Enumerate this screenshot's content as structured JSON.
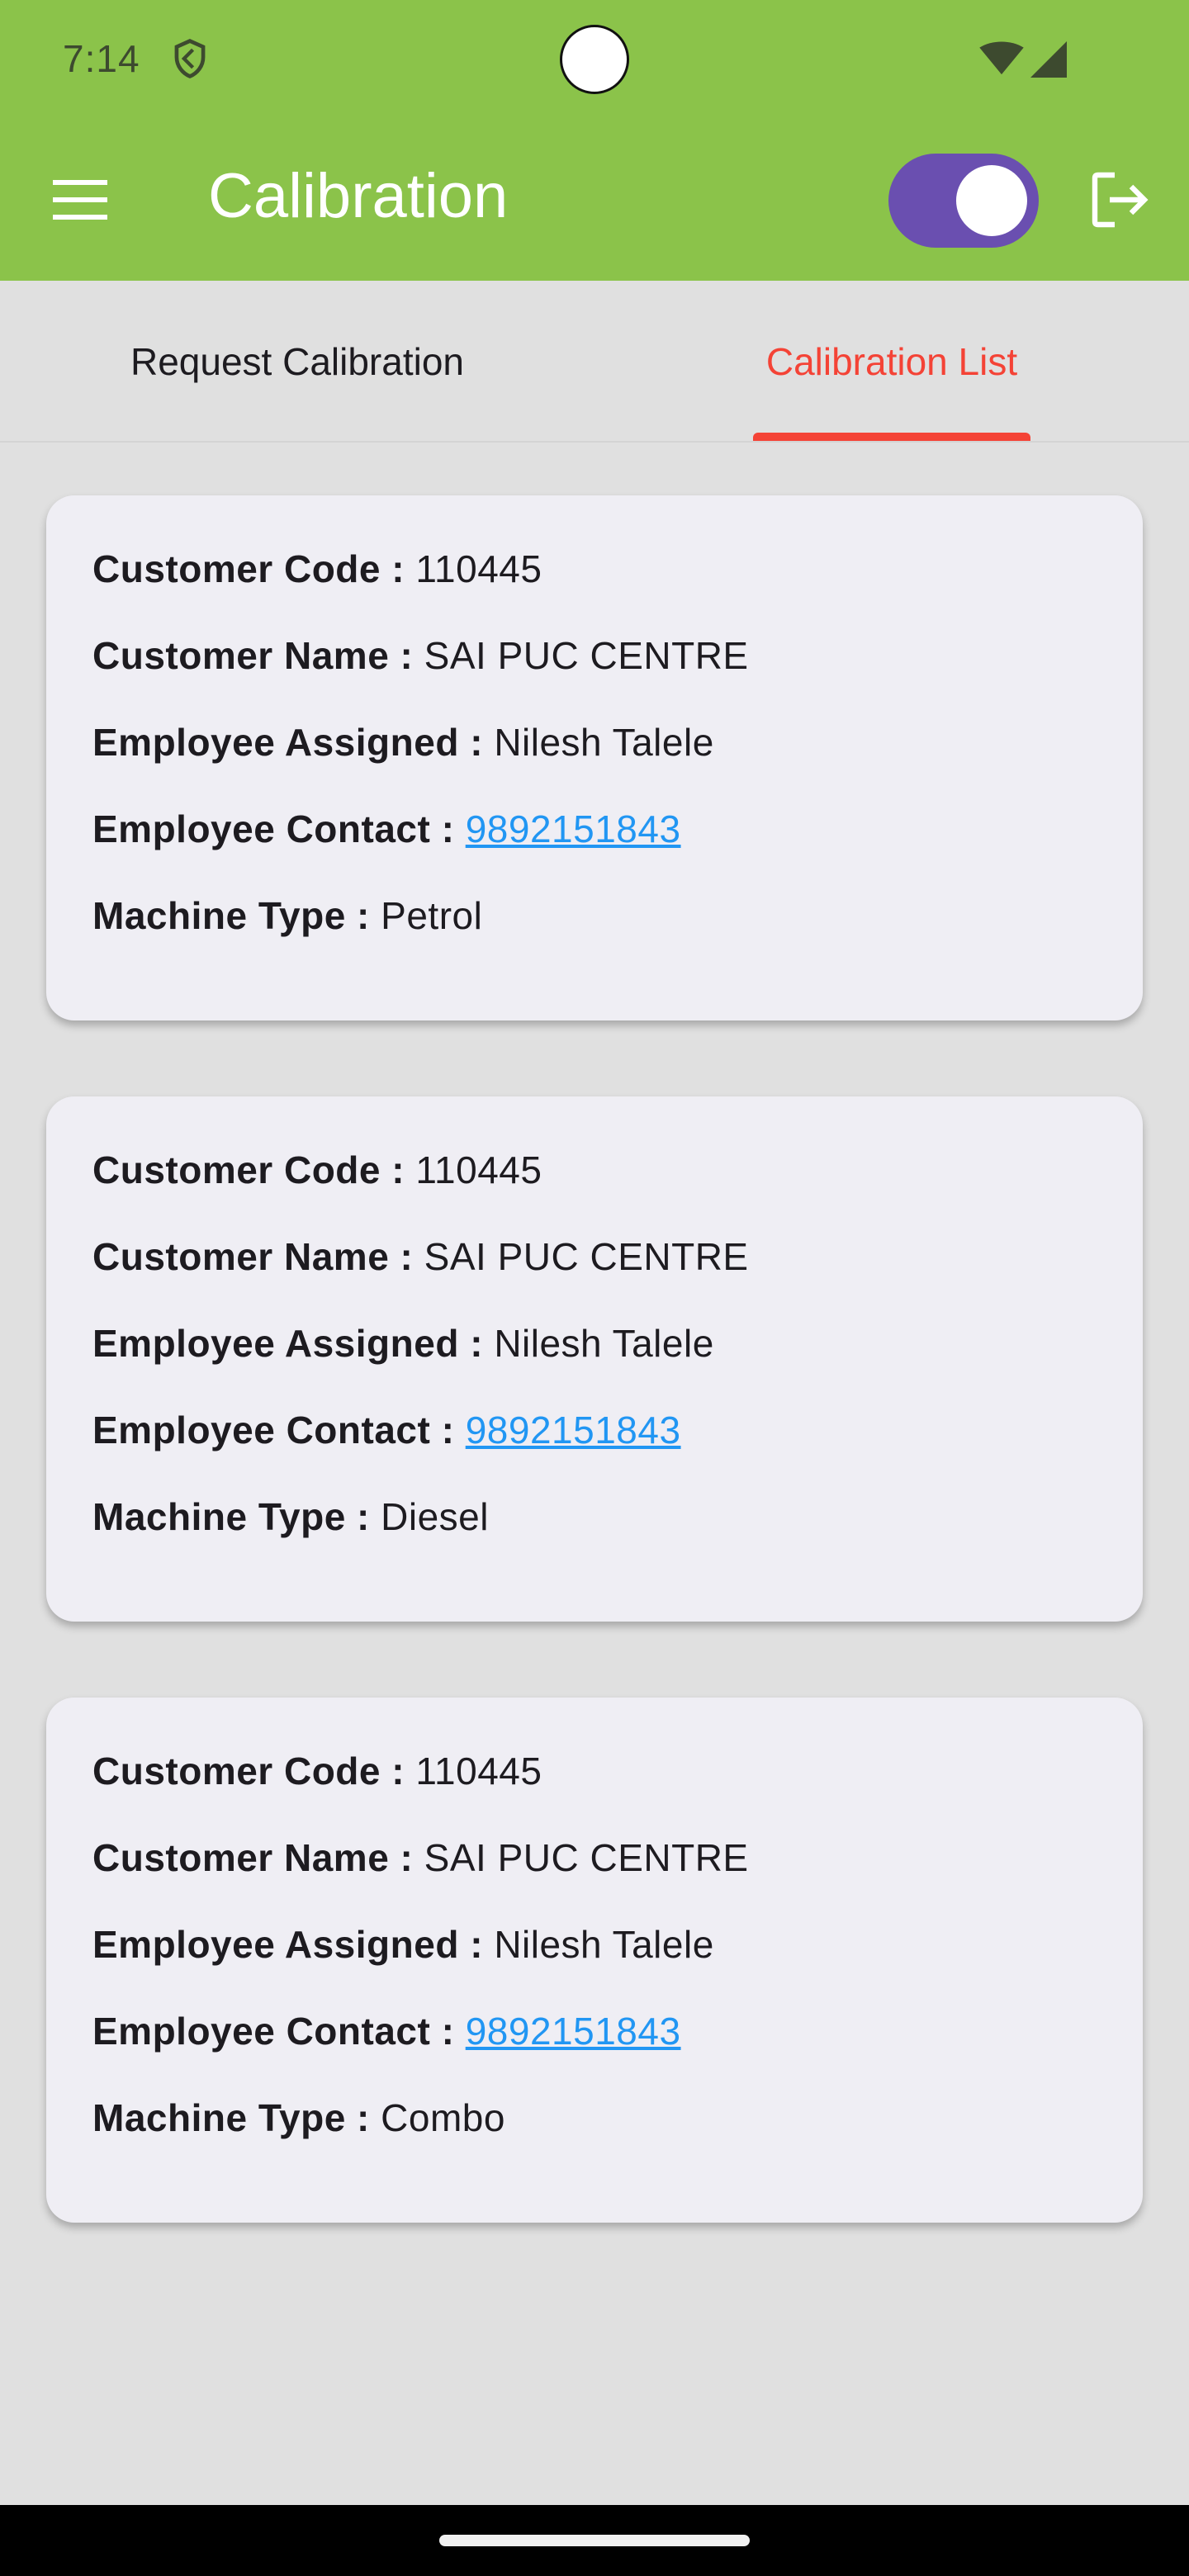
{
  "status_bar": {
    "time": "7:14"
  },
  "app_bar": {
    "title": "Calibration",
    "toggle_on": true
  },
  "tabs": [
    {
      "label": "Request Calibration",
      "selected": false
    },
    {
      "label": "Calibration List",
      "selected": true
    }
  ],
  "labels": {
    "customer_code": "Customer Code : ",
    "customer_name": "Customer Name : ",
    "employee_assigned": "Employee Assigned : ",
    "employee_contact": "Employee Contact : ",
    "machine_type": "Machine Type : "
  },
  "cards": [
    {
      "customer_code": "110445",
      "customer_name": "SAI PUC CENTRE",
      "employee_assigned": "Nilesh Talele",
      "employee_contact": "9892151843",
      "machine_type": "Petrol"
    },
    {
      "customer_code": "110445",
      "customer_name": "SAI PUC CENTRE",
      "employee_assigned": "Nilesh Talele",
      "employee_contact": "9892151843",
      "machine_type": "Diesel"
    },
    {
      "customer_code": "110445",
      "customer_name": "SAI PUC CENTRE",
      "employee_assigned": "Nilesh Talele",
      "employee_contact": "9892151843",
      "machine_type": "Combo"
    }
  ],
  "colors": {
    "app_bar": "#8bc34a",
    "toggle_track": "#6a4fb0",
    "tab_selected": "#f44336",
    "link": "#2196f3",
    "card_bg": "#efeef4",
    "page_bg": "#e0e0e0"
  },
  "icons": {
    "menu": "hamburger-menu-icon",
    "logout": "logout-icon",
    "shield": "shield-icon",
    "wifi": "wifi-icon",
    "signal": "cellular-signal-icon"
  }
}
